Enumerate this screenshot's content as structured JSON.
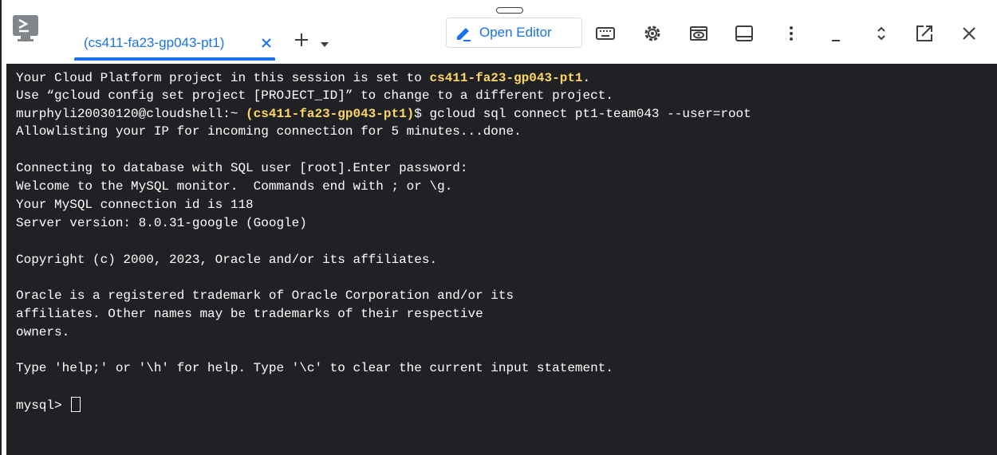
{
  "tab": {
    "label": "(cs411-fa23-gp043-pt1)"
  },
  "toolbar": {
    "open_editor_label": "Open Editor"
  },
  "icons": [
    "shell-logo-icon",
    "close-icon",
    "plus-icon",
    "chevron-down-icon",
    "pencil-icon",
    "keyboard-icon",
    "gear-icon",
    "web-preview-icon",
    "panel-icon",
    "more-vert-icon",
    "minimize-icon",
    "restore-icon",
    "open-new-window-icon",
    "close-icon"
  ],
  "colors": {
    "accent": "#1a73e8",
    "terminal_bg": "#202124",
    "highlight": "#fdd663"
  },
  "terminal": {
    "line1_prefix": "Your Cloud Platform project in this session is set to ",
    "line1_project": "cs411-fa23-gp043-pt1",
    "line1_suffix": ".",
    "line2": "Use “gcloud config set project [PROJECT_ID]” to change to a different project.",
    "line3_prompt": "murphyli20030120@cloudshell:~ ",
    "line3_project": "(cs411-fa23-gp043-pt1)",
    "line3_command": "$ gcloud sql connect pt1-team043 --user=root",
    "line4": "Allowlisting your IP for incoming connection for 5 minutes...done.",
    "line5": "Connecting to database with SQL user [root].Enter password:",
    "line6": "Welcome to the MySQL monitor.  Commands end with ; or \\g.",
    "line7": "Your MySQL connection id is 118",
    "line8": "Server version: 8.0.31-google (Google)",
    "line9": "Copyright (c) 2000, 2023, Oracle and/or its affiliates.",
    "line10": "Oracle is a registered trademark of Oracle Corporation and/or its",
    "line11": "affiliates. Other names may be trademarks of their respective",
    "line12": "owners.",
    "line13": "Type 'help;' or '\\h' for help. Type '\\c' to clear the current input statement.",
    "prompt": "mysql> "
  }
}
